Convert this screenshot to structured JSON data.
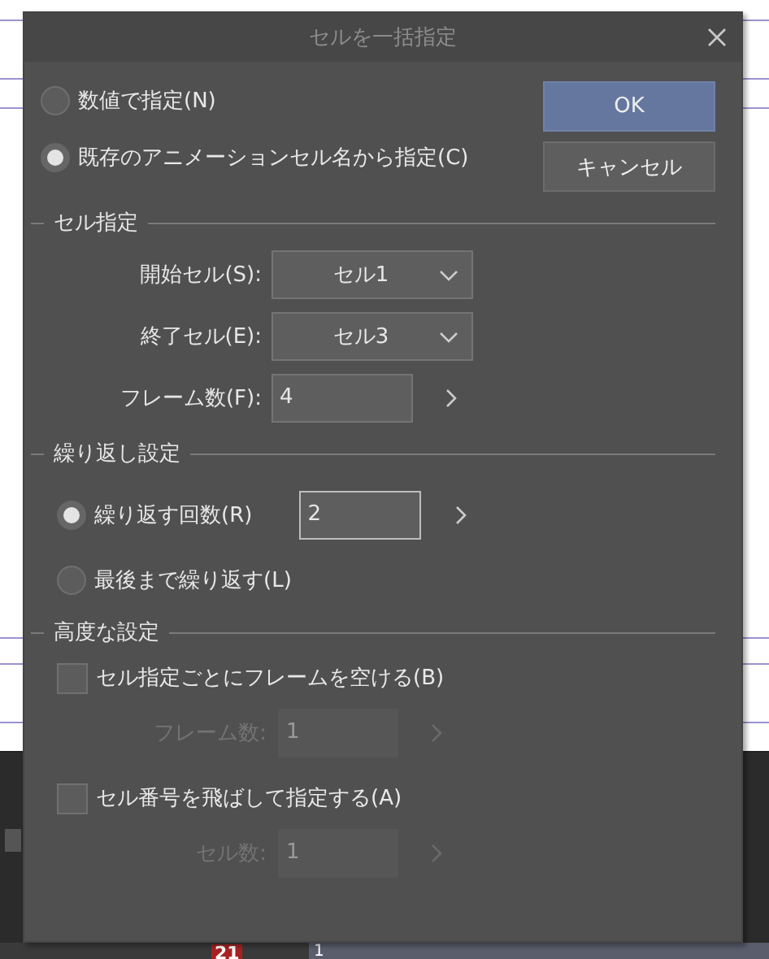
{
  "window": {
    "title": "セルを一括指定"
  },
  "mode_options": [
    {
      "label": "数値で指定(N)",
      "selected": false
    },
    {
      "label": "既存のアニメーションセル名から指定(C)",
      "selected": true
    }
  ],
  "buttons": [
    {
      "label": "OK",
      "kind": "primary"
    },
    {
      "label": "キャンセル",
      "kind": "normal"
    }
  ],
  "cell_section": {
    "title": "セル指定",
    "start_label": "開始セル(S):",
    "start_value": "セル1",
    "end_label": "終了セル(E):",
    "end_value": "セル3",
    "frames_label": "フレーム数(F):",
    "frames_value": "4"
  },
  "repeat_section": {
    "title": "繰り返し設定",
    "options": [
      {
        "label": "繰り返す回数(R)",
        "selected": true,
        "kind": "count",
        "value": "2"
      },
      {
        "label": "最後まで繰り返す(L)",
        "selected": false,
        "kind": "plain"
      }
    ]
  },
  "advanced_section": {
    "title": "高度な設定",
    "options": [
      {
        "label": "セル指定ごとにフレームを空ける(B)",
        "checked": false,
        "sub_label": "フレーム数:",
        "sub_value": "1"
      },
      {
        "label": "セル番号を飛ばして指定する(A)",
        "checked": false,
        "sub_label": "セル数:",
        "sub_value": "1"
      }
    ]
  },
  "background": {
    "frame_badge": "21",
    "cell_label": "1"
  }
}
